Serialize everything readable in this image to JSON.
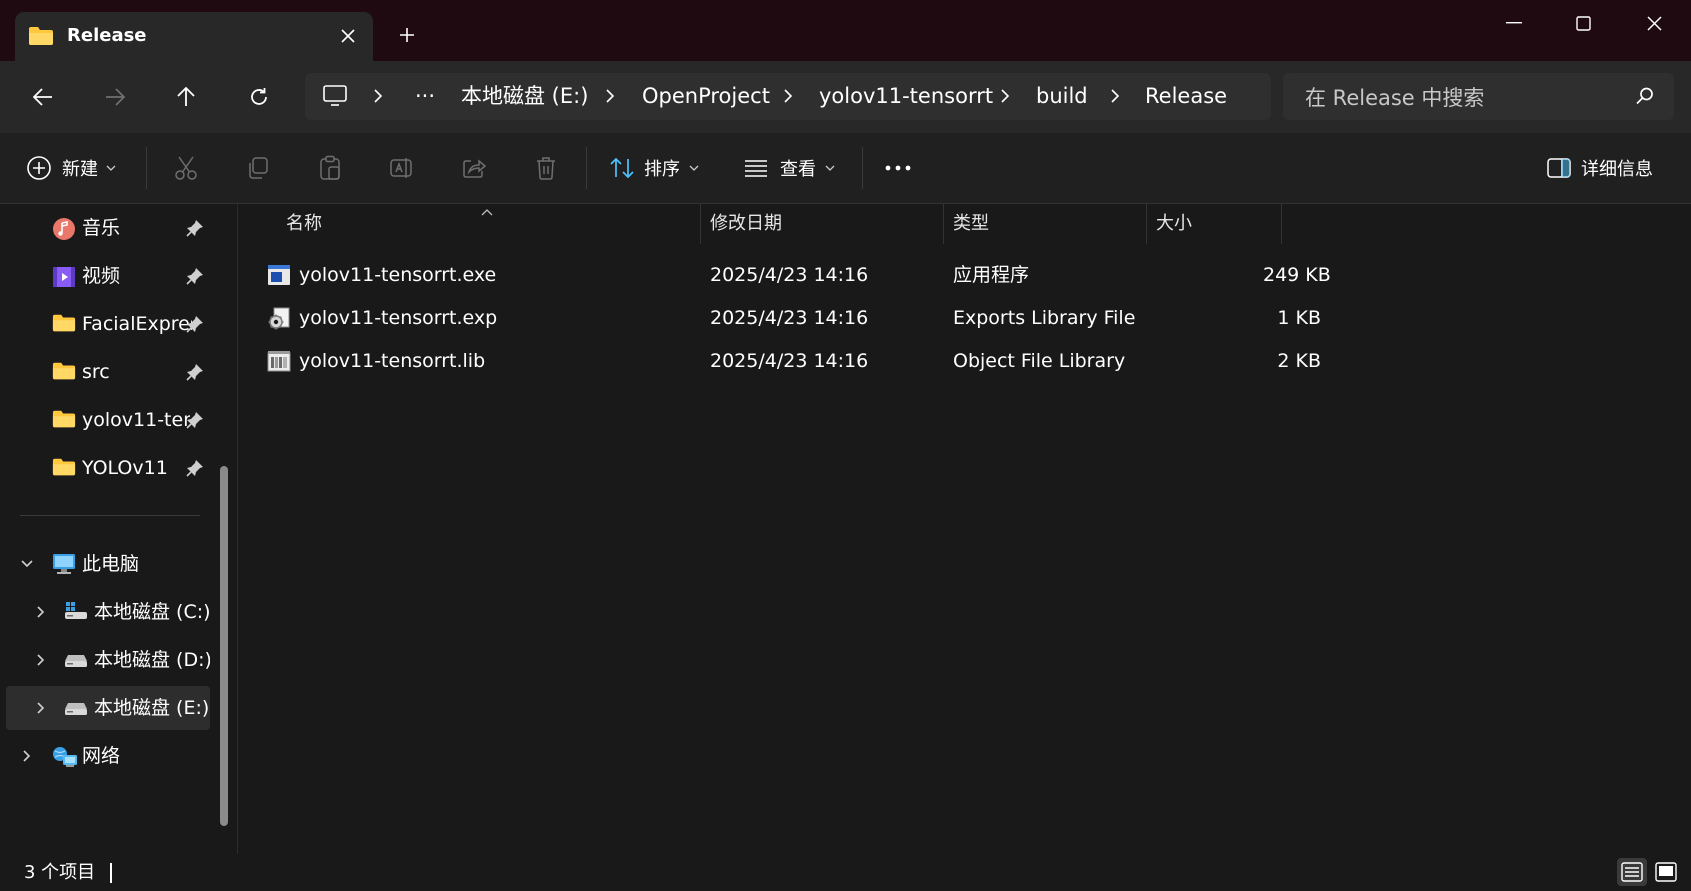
{
  "window": {
    "tab_title": "Release",
    "accent": "#ffc83d"
  },
  "address": {
    "overflow": "···",
    "crumbs": [
      "本地磁盘 (E:)",
      "OpenProject",
      "yolov11-tensorrt",
      "build",
      "Release"
    ]
  },
  "search": {
    "placeholder": "在 Release 中搜索"
  },
  "toolbar": {
    "new_label": "新建",
    "sort_label": "排序",
    "view_label": "查看",
    "details_label": "详细信息"
  },
  "sidebar": {
    "pinned": [
      {
        "label": "音乐",
        "icon": "music-icon"
      },
      {
        "label": "视频",
        "icon": "video-icon"
      },
      {
        "label": "FacialExpres",
        "icon": "folder-icon"
      },
      {
        "label": "src",
        "icon": "folder-icon"
      },
      {
        "label": "yolov11-ten",
        "icon": "folder-icon"
      },
      {
        "label": "YOLOv11",
        "icon": "folder-icon"
      }
    ],
    "this_pc": "此电脑",
    "drives": [
      {
        "label": "本地磁盘 (C:)",
        "icon": "windows-drive-icon"
      },
      {
        "label": "本地磁盘 (D:)",
        "icon": "drive-icon"
      },
      {
        "label": "本地磁盘 (E:)",
        "icon": "drive-icon",
        "selected": true
      }
    ],
    "network": "网络"
  },
  "table": {
    "columns": [
      "名称",
      "修改日期",
      "类型",
      "大小"
    ],
    "rows": [
      {
        "name": "yolov11-tensorrt.exe",
        "date": "2025/4/23 14:16",
        "type": "应用程序",
        "size": "249 KB",
        "icon": "exe-icon"
      },
      {
        "name": "yolov11-tensorrt.exp",
        "date": "2025/4/23 14:16",
        "type": "Exports Library File",
        "size": "1 KB",
        "icon": "exp-icon"
      },
      {
        "name": "yolov11-tensorrt.lib",
        "date": "2025/4/23 14:16",
        "type": "Object File Library",
        "size": "2 KB",
        "icon": "lib-icon"
      }
    ]
  },
  "status": {
    "count": "3 个项目"
  }
}
